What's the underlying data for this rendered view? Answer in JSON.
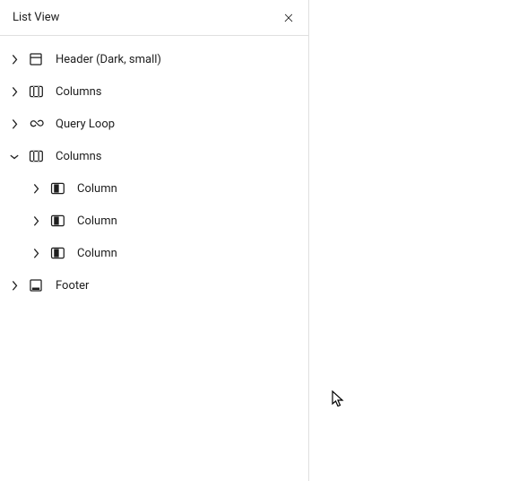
{
  "panel": {
    "title": "List View"
  },
  "tree": [
    {
      "label": "Header (Dark, small)",
      "icon": "header",
      "expanded": false,
      "depth": 0
    },
    {
      "label": "Columns",
      "icon": "columns",
      "expanded": false,
      "depth": 0
    },
    {
      "label": "Query Loop",
      "icon": "loop",
      "expanded": false,
      "depth": 0
    },
    {
      "label": "Columns",
      "icon": "columns",
      "expanded": true,
      "depth": 0
    },
    {
      "label": "Column",
      "icon": "column",
      "expanded": false,
      "depth": 1
    },
    {
      "label": "Column",
      "icon": "column",
      "expanded": false,
      "depth": 1
    },
    {
      "label": "Column",
      "icon": "column",
      "expanded": false,
      "depth": 1
    },
    {
      "label": "Footer",
      "icon": "footer",
      "expanded": false,
      "depth": 0
    }
  ]
}
